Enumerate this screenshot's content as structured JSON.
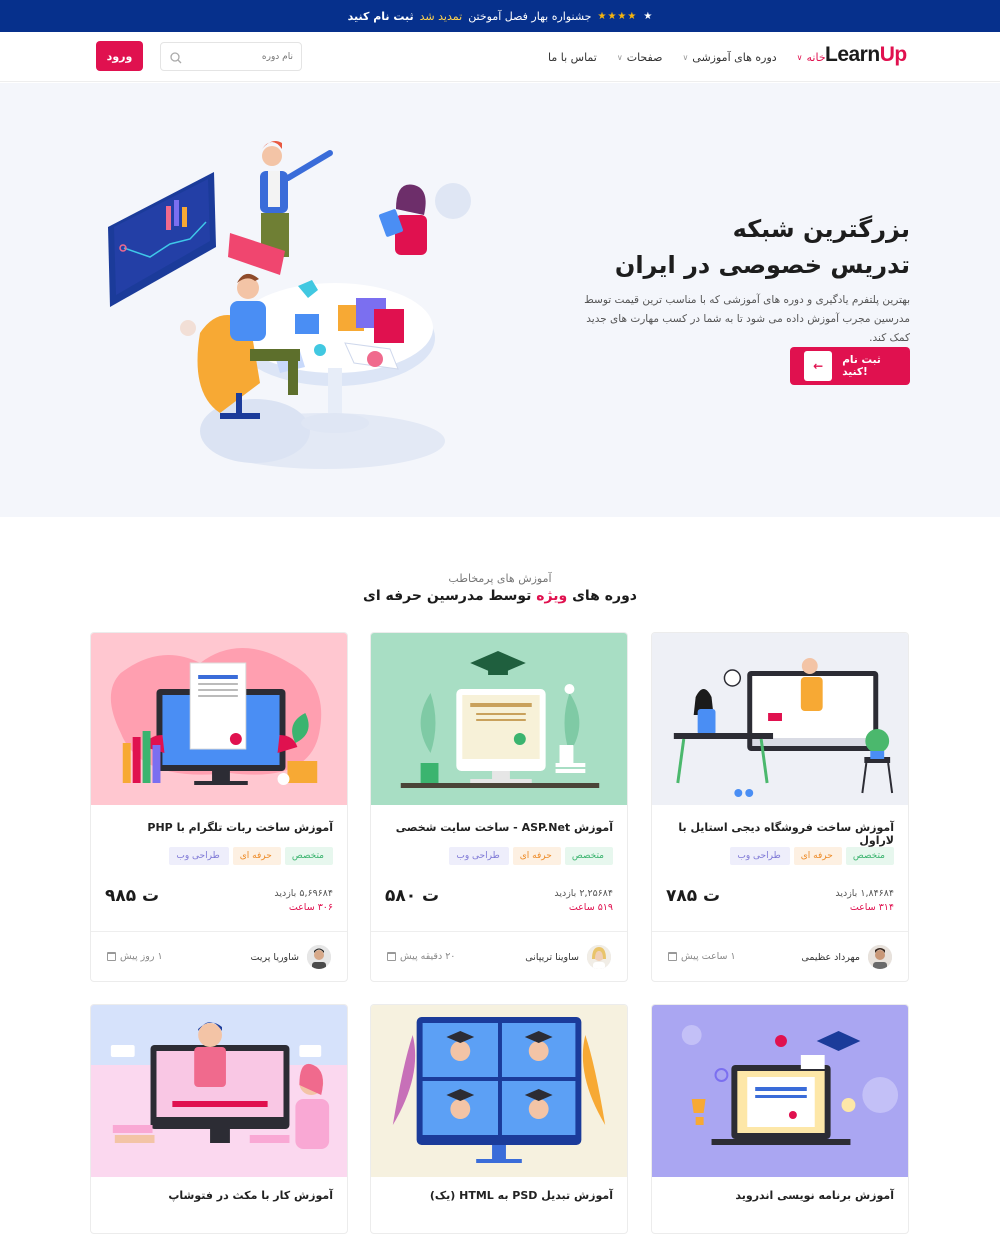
{
  "topbar": {
    "text_main": "جشنواره بهار فصل آموختن",
    "text_highlight": "تمدید شد",
    "text_register": "ثبت نام کنید",
    "stars": "★★★★",
    "star_white": "★"
  },
  "header": {
    "logo_learn": "Learn",
    "logo_up": "Up",
    "nav": [
      {
        "label": "خانه",
        "active": true,
        "has_dropdown": true
      },
      {
        "label": "دوره های آموزشی",
        "has_dropdown": true
      },
      {
        "label": "صفحات",
        "has_dropdown": true
      },
      {
        "label": "تماس با ما",
        "has_dropdown": false
      }
    ],
    "search_placeholder": "نام دوره",
    "login_label": "ورود"
  },
  "hero": {
    "title_line1": "بزرگترین شبکه",
    "title_line2": "تدریس خصوصی در ایران",
    "description": "بهترین پلتفرم یادگیری و دوره های آموزشی که با مناسب ترین قیمت توسط مدرسین مجرب آموزش داده می شود تا به شما در کسب مهارت های جدید کمک کند.",
    "cta_label": "ثبت نام کنید!",
    "cta_icon": "arrow-left-icon"
  },
  "section": {
    "subtitle": "آموزش های پرمخاطب",
    "title_prefix": "دوره های",
    "title_highlight": "ویژه",
    "title_suffix": "توسط مدرسین حرفه ای"
  },
  "courses": [
    {
      "title": "آموزش ساخت فروشگاه دیجی استایل با لاراول",
      "tags": [
        "متخصص",
        "حرفه ای",
        "طراحی وب"
      ],
      "price": "۷۸۵ ت",
      "views": "۱,۸۴۶۸۴ بازدید",
      "hours": "۳۱۴ ساعت",
      "teacher": "مهرداد عظیمی",
      "time": "۱ ساعت پیش"
    },
    {
      "title": "آموزش ASP.Net - ساخت سایت شخصی",
      "tags": [
        "متخصص",
        "حرفه ای",
        "طراحی وب"
      ],
      "price": "۵۸۰ ت",
      "views": "۲,۲۵۶۸۴ بازدید",
      "hours": "۵۱۹ ساعت",
      "teacher": "ساوینا تریپانی",
      "time": "۲۰ دقیقه پیش"
    },
    {
      "title": "آموزش ساخت ربات تلگرام با PHP",
      "tags": [
        "متخصص",
        "حرفه ای",
        "طراحی وب"
      ],
      "price": "۹۸۵ ت",
      "views": "۵,۶۹۶۸۴ بازدید",
      "hours": "۳۰۶ ساعت",
      "teacher": "شاوریا پریت",
      "time": "۱ روز پیش"
    },
    {
      "title": "آموزش برنامه نویسی اندروید"
    },
    {
      "title": "آموزش تبدیل PSD به HTML (یک)"
    },
    {
      "title": "آموزش کار با مکث در فتوشاپ"
    }
  ],
  "colors": {
    "brand": "#e0114f",
    "topbar": "#06308c",
    "hero_bg": "#f4f6fb"
  }
}
